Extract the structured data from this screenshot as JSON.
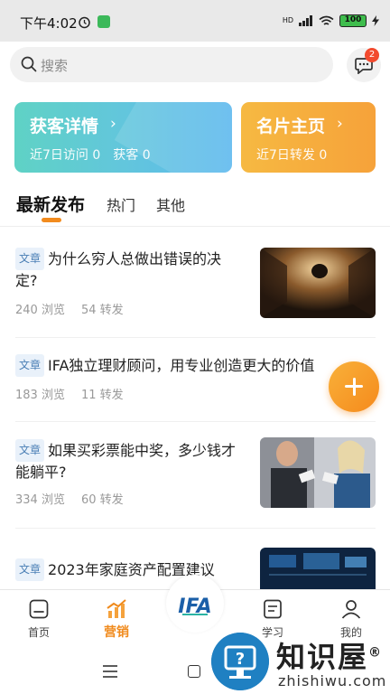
{
  "status_bar": {
    "time": "下午4:02",
    "network": "HD",
    "battery": "100"
  },
  "search": {
    "placeholder": "搜索"
  },
  "messages": {
    "badge": "2"
  },
  "cards": {
    "leads": {
      "title": "获客详情",
      "stats": "近7日访问 0　获客 0"
    },
    "profile": {
      "title": "名片主页",
      "stats": "近7日转发 0"
    }
  },
  "tabs": [
    "最新发布",
    "热门",
    "其他"
  ],
  "articles": [
    {
      "tag": "文章",
      "title_line1": "为什么穷人总做出错误的决",
      "title_line2": "定?",
      "views": "240 浏览",
      "shares": "54 转发"
    },
    {
      "tag": "文章",
      "title_line1": "IFA独立理财顾问，用专业创造更大的价值",
      "title_line2": "",
      "views": "183 浏览",
      "shares": "11 转发"
    },
    {
      "tag": "文章",
      "title_line1": "如果买彩票能中奖，多少钱才",
      "title_line2": "能躺平?",
      "views": "334 浏览",
      "shares": "60 转发"
    },
    {
      "tag": "文章",
      "title_line1": "2023年家庭资产配置建议",
      "title_line2": "",
      "views": "",
      "shares": ""
    }
  ],
  "bottom_nav": {
    "home": "首页",
    "marketing": "营销",
    "center_logo": "IFA",
    "learn": "学习",
    "mine": "我的"
  },
  "watermark": {
    "name": "知识屋",
    "registered": "®",
    "domain": "zhishiwu.com"
  },
  "colors": {
    "accent": "#f28b1e",
    "leads_card": "#5fc8dc",
    "profile_card": "#f6ad3e",
    "badge": "#f24a2e",
    "tag_text": "#4a7fb5"
  }
}
